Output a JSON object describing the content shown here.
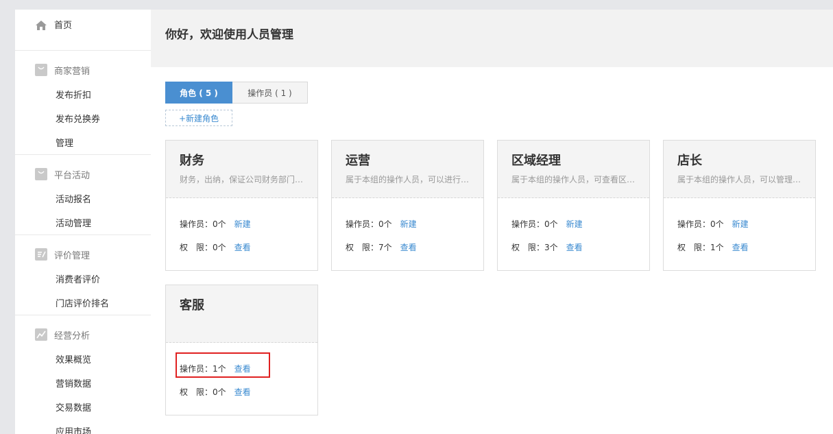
{
  "sidebar": {
    "home": "首页",
    "groups": [
      {
        "title": "商家营销",
        "items": [
          "发布折扣",
          "发布兑换券",
          "管理"
        ]
      },
      {
        "title": "平台活动",
        "items": [
          "活动报名",
          "活动管理"
        ]
      },
      {
        "title": "评价管理",
        "items": [
          "消费者评价",
          "门店评价排名"
        ]
      },
      {
        "title": "经营分析",
        "items": [
          "效果概览",
          "营销数据",
          "交易数据",
          "应用市场"
        ]
      }
    ]
  },
  "header": {
    "title": "你好，欢迎使用人员管理"
  },
  "tabs": [
    {
      "label": "角色 ( 5 )",
      "active": true
    },
    {
      "label": "操作员 ( 1 )",
      "active": false
    }
  ],
  "new_role_label": "+新建角色",
  "cards": [
    {
      "title": "财务",
      "desc": "财务，出纳，保证公司财务部门…",
      "operators": "操作员：0个",
      "operator_link": "新建",
      "perm_label": "权　限：0个",
      "perm_link": "查看"
    },
    {
      "title": "运营",
      "desc": "属于本组的操作人员，可以进行…",
      "operators": "操作员：0个",
      "operator_link": "新建",
      "perm_label": "权　限：7个",
      "perm_link": "查看"
    },
    {
      "title": "区域经理",
      "desc": "属于本组的操作人员，可查看区…",
      "operators": "操作员：0个",
      "operator_link": "新建",
      "perm_label": "权　限：3个",
      "perm_link": "查看"
    },
    {
      "title": "店长",
      "desc": "属于本组的操作人员，可以管理…",
      "operators": "操作员：0个",
      "operator_link": "新建",
      "perm_label": "权　限：1个",
      "perm_link": "查看"
    },
    {
      "title": "客服",
      "desc": "",
      "operators": "操作员：1个",
      "operator_link": "查看",
      "perm_label": "权　限：0个",
      "perm_link": "查看"
    }
  ],
  "colors": {
    "accent": "#4a8fd1",
    "link": "#3a8ad0",
    "highlight": "#e02020"
  }
}
